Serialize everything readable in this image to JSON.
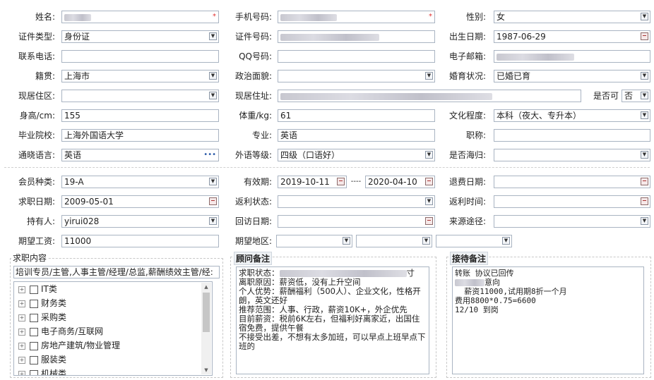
{
  "form": {
    "name": {
      "label": "姓名:"
    },
    "mobile": {
      "label": "手机号码:"
    },
    "gender": {
      "label": "性别:",
      "value": "女"
    },
    "id_type": {
      "label": "证件类型:",
      "value": "身份证"
    },
    "id_no": {
      "label": "证件号码:"
    },
    "birth": {
      "label": "出生日期:",
      "value": "1987-06-29"
    },
    "phone": {
      "label": "联系电话:"
    },
    "qq": {
      "label": "QQ号码:"
    },
    "email": {
      "label": "电子邮箱:"
    },
    "native": {
      "label": "籍贯:",
      "value": "上海市"
    },
    "political": {
      "label": "政治面貌:"
    },
    "marital": {
      "label": "婚育状况:",
      "value": "已婚已育"
    },
    "district": {
      "label": "现居住区:"
    },
    "address": {
      "label": "现居住址:"
    },
    "is_possible": {
      "label": "是否可",
      "value": "否"
    },
    "height": {
      "label": "身高/cm:",
      "value": "155"
    },
    "weight": {
      "label": "体重/kg:",
      "value": "61"
    },
    "education": {
      "label": "文化程度:",
      "value": "本科（夜大、专升本）"
    },
    "school": {
      "label": "毕业院校:",
      "value": "上海外国语大学"
    },
    "major": {
      "label": "专业:",
      "value": "英语"
    },
    "title": {
      "label": "职称:"
    },
    "language": {
      "label": "通晓语言:",
      "value": "英语",
      "more": "•••"
    },
    "lang_level": {
      "label": "外语等级:",
      "value": "四级（口语好）"
    },
    "overseas": {
      "label": "是否海归:"
    },
    "member_type": {
      "label": "会员种类:",
      "value": "19-A"
    },
    "valid_period": {
      "label": "有效期:",
      "from": "2019-10-11",
      "sep": "----",
      "to": "2020-04-10"
    },
    "refund_date": {
      "label": "退费日期:"
    },
    "job_date": {
      "label": "求职日期:",
      "value": "2009-05-01"
    },
    "rebate_status": {
      "label": "返利状态:"
    },
    "rebate_time": {
      "label": "返利时间:"
    },
    "holder": {
      "label": "持有人:",
      "value": "yirui028"
    },
    "visit_date": {
      "label": "回访日期:"
    },
    "source": {
      "label": "来源途径:"
    },
    "salary": {
      "label": "期望工资:",
      "value": "11000"
    },
    "area": {
      "label": "期望地区:"
    }
  },
  "job_content": {
    "legend": "求职内容",
    "selected": "培训专员/主管,人事主管/经理/总监,薪酬绩效主管/经:",
    "tree": [
      "IT类",
      "财务类",
      "采购类",
      "电子商务/互联网",
      "房地产建筑/物业管理",
      "服装类",
      "机械类"
    ]
  },
  "advisor_notes": {
    "legend": "顾问备注",
    "status_prefix": "求职状态：",
    "status_suffix": "寸",
    "body": "离职原因：薪资低，没有上升空间\n个人优势：薪酬福利（500人）、企业文化，性格开朗，英文还好\n推荐范围：人事、行政，薪资10K+，外企优先\n目前薪资：税前6K左右，但福利好离家近，出国住宿免费，提供午餐\n不接受出差，不想有太多加班，可以早点上班早点下班的"
  },
  "reception_notes": {
    "legend": "接待备注",
    "line1": "转账 协议已回传",
    "line2_suffix": "意向",
    "line3": "  薪资11000,试用期8折一个月",
    "line4": "费用8800*0.75=6600",
    "line5": "12/10 到岗"
  }
}
